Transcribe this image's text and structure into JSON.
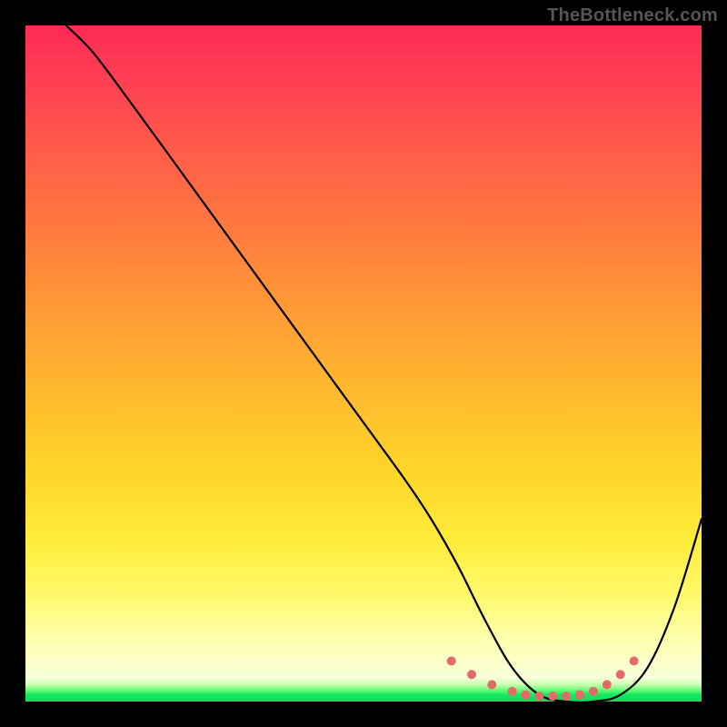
{
  "watermark": "TheBottleneck.com",
  "chart_data": {
    "type": "line",
    "title": "",
    "xlabel": "",
    "ylabel": "",
    "xlim": [
      0,
      100
    ],
    "ylim": [
      0,
      100
    ],
    "grid": false,
    "legend": false,
    "gradient_background": {
      "direction": "vertical",
      "stops": [
        {
          "pos": 0,
          "color": "#ff2a55"
        },
        {
          "pos": 50,
          "color": "#ffb92e"
        },
        {
          "pos": 85,
          "color": "#fff86a"
        },
        {
          "pos": 95,
          "color": "#fdffc8"
        },
        {
          "pos": 100,
          "color": "#0fd95a"
        }
      ]
    },
    "series": [
      {
        "name": "bottleneck-curve",
        "x": [
          6,
          10,
          16,
          24,
          32,
          40,
          48,
          56,
          60,
          64,
          68,
          72,
          76,
          80,
          84,
          88,
          92,
          96,
          100
        ],
        "y": [
          100,
          96,
          88,
          77,
          66,
          55,
          44,
          33,
          27,
          20,
          12,
          5,
          1,
          0,
          0,
          1,
          5,
          14,
          27
        ]
      }
    ],
    "highlight_zone": {
      "name": "optimal-band-dots",
      "x": [
        63,
        66,
        69,
        72,
        74,
        76,
        78,
        80,
        82,
        84,
        86,
        88,
        90
      ],
      "y": [
        6,
        4,
        2.5,
        1.5,
        1,
        0.8,
        0.8,
        0.8,
        1,
        1.5,
        2.5,
        4,
        6
      ],
      "marker_color": "#e46a6a",
      "marker_radius": 5
    }
  }
}
